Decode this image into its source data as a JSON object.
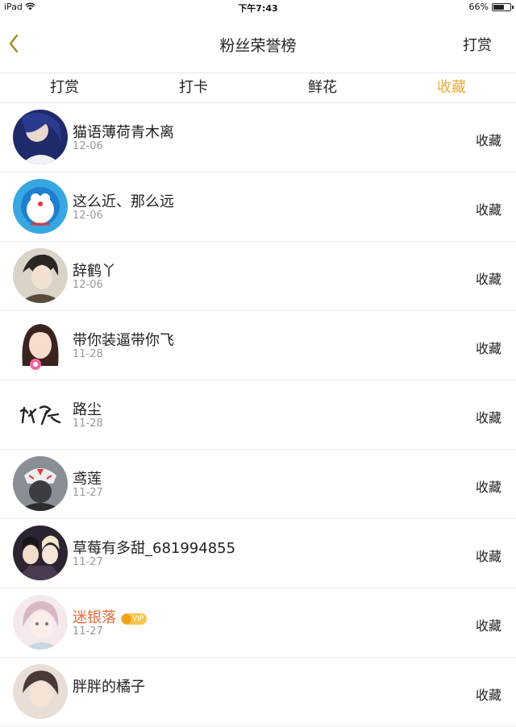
{
  "status_bar": {
    "device": "iPad",
    "time": "下午7:43",
    "battery_pct": "66%",
    "battery_level": 0.66
  },
  "header": {
    "back_icon": "chevron-left-icon",
    "title": "粉丝荣誉榜",
    "right_action": "打赏",
    "accent": "#e9a93b"
  },
  "tabs": [
    {
      "label": "打赏",
      "active": false
    },
    {
      "label": "打卡",
      "active": false
    },
    {
      "label": "鲜花",
      "active": false
    },
    {
      "label": "收藏",
      "active": true
    }
  ],
  "fans": [
    {
      "name": "猫语薄荷青木离",
      "date": "12-06",
      "action": "收藏",
      "vip": false
    },
    {
      "name": "这么近、那么远",
      "date": "12-06",
      "action": "收藏",
      "vip": false
    },
    {
      "name": "辞鹤丫",
      "date": "12-06",
      "action": "收藏",
      "vip": false
    },
    {
      "name": "带你装逼带你飞",
      "date": "11-28",
      "action": "收藏",
      "vip": false
    },
    {
      "name": "路尘",
      "date": "11-28",
      "action": "收藏",
      "vip": false
    },
    {
      "name": "鸢莲",
      "date": "11-27",
      "action": "收藏",
      "vip": false
    },
    {
      "name": "草莓有多甜_681994855",
      "date": "11-27",
      "action": "收藏",
      "vip": false
    },
    {
      "name": "迷银落",
      "date": "11-27",
      "action": "收藏",
      "vip": true,
      "vip_label": "VIP"
    },
    {
      "name": "胖胖的橘子",
      "date": "",
      "action": "收藏",
      "vip": false
    }
  ]
}
